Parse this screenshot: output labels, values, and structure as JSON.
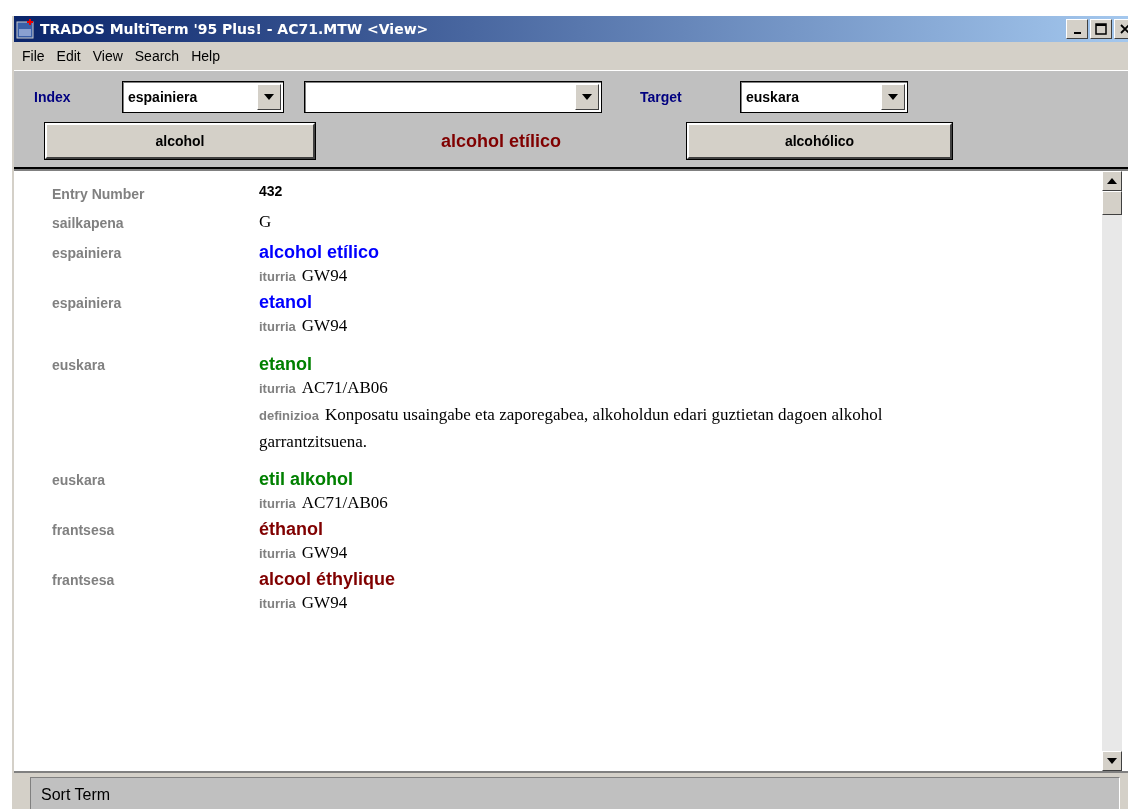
{
  "window": {
    "title": "TRADOS MultiTerm '95 Plus! - AC71.MTW <View>"
  },
  "menu": [
    "File",
    "Edit",
    "View",
    "Search",
    "Help"
  ],
  "toolbar": {
    "index_label": "Index",
    "index_value": "espainiera",
    "target_label": "Target",
    "target_value": "euskara",
    "previous_term": "alcohol",
    "current_term": "alcohol etílico",
    "next_term": "alcohólico"
  },
  "header_fields": [
    {
      "kind": "number",
      "label": "Entry Number",
      "value": "432"
    },
    {
      "kind": "plain",
      "label": "sailkapena",
      "value": "G"
    }
  ],
  "terms": [
    {
      "language": "espainiera",
      "term": "alcohol etílico",
      "color": "#0000ff",
      "details": [
        {
          "label": "iturria",
          "value": "GW94"
        }
      ]
    },
    {
      "language": "espainiera",
      "term": "etanol",
      "color": "#0000ff",
      "details": [
        {
          "label": "iturria",
          "value": "GW94"
        }
      ]
    },
    {
      "language": "euskara",
      "term": "etanol",
      "color": "#008000",
      "details": [
        {
          "label": "iturria",
          "value": "AC71/AB06"
        },
        {
          "label": "definizioa",
          "value": "Konposatu usaingabe eta zaporegabea, alkoholdun edari guztietan dagoen alkohol garrantzitsuena."
        }
      ]
    },
    {
      "language": "euskara",
      "term": "etil alkohol",
      "color": "#008000",
      "details": [
        {
          "label": "iturria",
          "value": "AC71/AB06"
        }
      ]
    },
    {
      "language": "frantsesa",
      "term": "éthanol",
      "color": "#800000",
      "details": [
        {
          "label": "iturria",
          "value": "GW94"
        }
      ]
    },
    {
      "language": "frantsesa",
      "term": "alcool éthylique",
      "color": "#800000",
      "details": [
        {
          "label": "iturria",
          "value": "GW94"
        }
      ]
    }
  ],
  "status_bar": {
    "text": "Sort Term"
  }
}
